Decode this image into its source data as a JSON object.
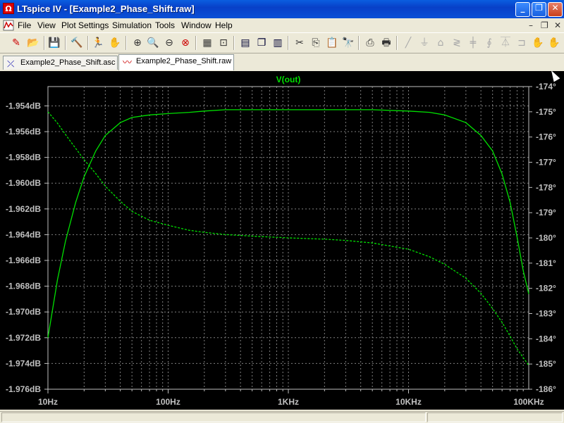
{
  "window": {
    "title": "LTspice IV - [Example2_Phase_Shift.raw]",
    "app_icon_text": "Ω",
    "buttons": {
      "minimize": "_",
      "restore": "❐",
      "close": "✕"
    }
  },
  "menu": {
    "items": [
      "File",
      "View",
      "Plot Settings",
      "Simulation",
      "Tools",
      "Window",
      "Help"
    ],
    "mdi_buttons": [
      "–",
      "❐",
      "✕"
    ]
  },
  "tabs": [
    {
      "label": "Example2_Phase_Shift.asc",
      "icon": "schematic-icon",
      "active": false
    },
    {
      "label": "Example2_Phase_Shift.raw",
      "icon": "waveform-icon",
      "active": true
    }
  ],
  "chart_data": {
    "type": "line",
    "title": "V(out)",
    "x_scale": "log",
    "x_ticks": [
      "10Hz",
      "100Hz",
      "1KHz",
      "10KHz",
      "100KHz"
    ],
    "x_range": [
      10,
      100000
    ],
    "y_left_ticks": [
      "-1.954dB",
      "-1.956dB",
      "-1.958dB",
      "-1.960dB",
      "-1.962dB",
      "-1.964dB",
      "-1.966dB",
      "-1.968dB",
      "-1.970dB",
      "-1.972dB",
      "-1.974dB",
      "-1.976dB"
    ],
    "y_left_range": [
      -1.976,
      -1.9525
    ],
    "y_right_ticks": [
      "-174°",
      "-175°",
      "-176°",
      "-177°",
      "-178°",
      "-179°",
      "-180°",
      "-181°",
      "-182°",
      "-183°",
      "-184°",
      "-185°",
      "-186°"
    ],
    "y_right_range": [
      -186,
      -174
    ],
    "grid": true,
    "colors": {
      "background": "#000000",
      "trace": "#00e000",
      "axis": "#c0c0c0",
      "grid": "#808080",
      "title": "#00e000"
    },
    "series": [
      {
        "name": "V(out)",
        "quantity": "magnitude",
        "axis": "left",
        "style": "solid",
        "x": [
          10,
          12,
          14,
          17,
          20,
          25,
          30,
          40,
          50,
          70,
          100,
          150,
          200,
          300,
          500,
          1000,
          2000,
          5000,
          10000,
          15000,
          20000,
          30000,
          40000,
          50000,
          60000,
          70000,
          80000,
          90000,
          100000
        ],
        "y": [
          -1.972,
          -1.9675,
          -1.9645,
          -1.9615,
          -1.9595,
          -1.9575,
          -1.9563,
          -1.9553,
          -1.9549,
          -1.9547,
          -1.9546,
          -1.9545,
          -1.9544,
          -1.9543,
          -1.9543,
          -1.9543,
          -1.9543,
          -1.9543,
          -1.9544,
          -1.9545,
          -1.9547,
          -1.9553,
          -1.9563,
          -1.9575,
          -1.9593,
          -1.9615,
          -1.9642,
          -1.9668,
          -1.9686
        ]
      },
      {
        "name": "V(out)",
        "quantity": "phase",
        "axis": "right",
        "style": "dashed",
        "x": [
          10,
          12,
          15,
          20,
          25,
          30,
          40,
          50,
          70,
          100,
          150,
          200,
          300,
          500,
          1000,
          2000,
          3000,
          5000,
          10000,
          15000,
          20000,
          30000,
          40000,
          50000,
          60000,
          70000,
          80000,
          90000,
          100000
        ],
        "y": [
          -175.0,
          -175.45,
          -176.1,
          -176.9,
          -177.45,
          -177.95,
          -178.55,
          -178.95,
          -179.3,
          -179.5,
          -179.7,
          -179.78,
          -179.87,
          -179.93,
          -180.0,
          -180.05,
          -180.1,
          -180.2,
          -180.45,
          -180.75,
          -181.05,
          -181.6,
          -182.2,
          -182.8,
          -183.35,
          -183.9,
          -184.4,
          -184.75,
          -185.05
        ]
      }
    ]
  }
}
